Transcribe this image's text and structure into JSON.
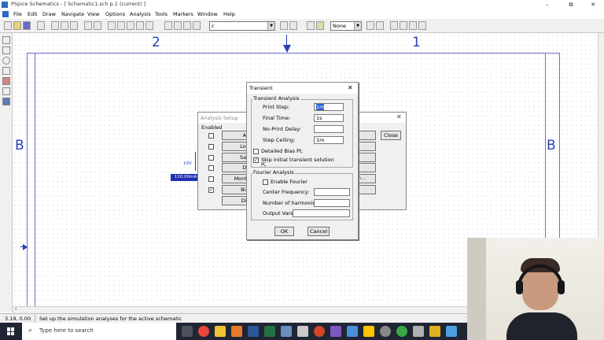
{
  "window": {
    "title": "PSpice Schematics - [ Schematic1.sch  p.1 (current) ]",
    "minimize": "–",
    "maximize": "⧉",
    "close": "✕"
  },
  "menu": [
    "File",
    "Edit",
    "Draw",
    "Navigate",
    "View",
    "Options",
    "Analysis",
    "Tools",
    "Markers",
    "Window",
    "Help"
  ],
  "toolbar": {
    "part_combo": "c",
    "zoom_combo": "None"
  },
  "canvas": {
    "zone_2": "2",
    "zone_1": "1",
    "zone_b_left": "B",
    "zone_b_right": "B",
    "part_voltage": "10V",
    "part_current": "110.00mA"
  },
  "analysis_setup": {
    "title": "Analysis Setup",
    "enabled_label": "Enabled",
    "close_label": "Close",
    "rows": [
      {
        "label": "AC",
        "checked": false
      },
      {
        "label": "Load",
        "checked": false
      },
      {
        "label": "Save",
        "checked": false
      },
      {
        "label": "DC",
        "checked": false
      },
      {
        "label": "Monte Ca",
        "checked": false
      },
      {
        "label": "Bias",
        "checked": true
      },
      {
        "label": "Digi",
        "checked": false
      }
    ],
    "partial_text": "n..."
  },
  "transient": {
    "title": "Transient",
    "group_transient": "Transient Analysis",
    "print_step_label": "Print Step:",
    "print_step_value": "1m",
    "final_time_label": "Final Time:",
    "final_time_value": "1s",
    "no_print_delay_label": "No-Print Delay:",
    "no_print_delay_value": "",
    "step_ceiling_label": "Step Ceiling:",
    "step_ceiling_value": "1m",
    "detailed_bias_label": "Detailed Bias Pt.",
    "detailed_bias_checked": false,
    "skip_initial_label": "Skip initial transient solution",
    "skip_initial_checked": true,
    "group_fourier": "Fourier Analysis",
    "enable_fourier_label": "Enable Fourier",
    "enable_fourier_checked": false,
    "center_freq_label": "Center Frequency:",
    "harmonics_label": "Number of harmonics:",
    "output_vars_label": "Output Vars.:",
    "ok_label": "OK",
    "cancel_label": "Cancel"
  },
  "statusbar": {
    "coords": "3.19, 0.00",
    "message": "Set up the simulation analyses for the active schematic"
  },
  "taskbar": {
    "search_placeholder": "Type here to search"
  }
}
